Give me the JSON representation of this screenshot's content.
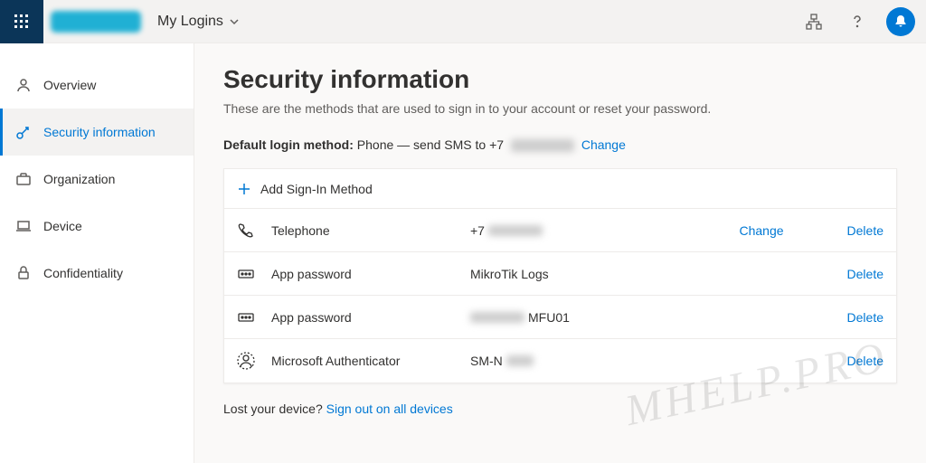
{
  "header": {
    "title": "My Logins"
  },
  "sidebar": {
    "items": [
      {
        "label": "Overview"
      },
      {
        "label": "Security information"
      },
      {
        "label": "Organization"
      },
      {
        "label": "Device"
      },
      {
        "label": "Confidentiality"
      }
    ]
  },
  "page": {
    "heading": "Security information",
    "subtitle": "These are the methods that are used to sign in to your account or reset your password.",
    "default_label": "Default login method:",
    "default_value_prefix": "Phone — send SMS to +7",
    "change_label": "Change",
    "add_method_label": "Add Sign-In Method",
    "lost_text": "Lost your device?",
    "lost_link": "Sign out on all devices"
  },
  "methods": [
    {
      "name": "Telephone",
      "value_prefix": "+7",
      "change": "Change",
      "delete": "Delete"
    },
    {
      "name": "App password",
      "value": "MikroTik Logs",
      "delete": "Delete"
    },
    {
      "name": "App password",
      "value_suffix": "MFU01",
      "delete": "Delete"
    },
    {
      "name": "Microsoft Authenticator",
      "value_prefix": "SM-N",
      "delete": "Delete"
    }
  ],
  "watermark": "MHELP.PRO"
}
